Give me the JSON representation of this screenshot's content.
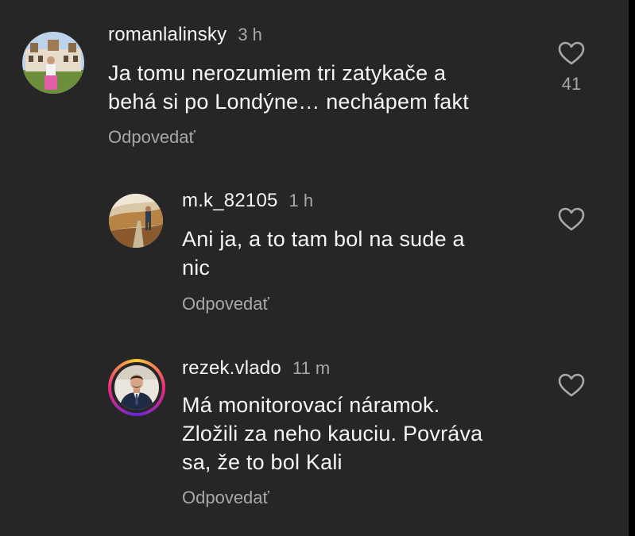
{
  "comments": [
    {
      "username": "romanlalinsky",
      "time": "3 h",
      "text_lines": [
        "Ja tomu nerozumiem tri zatykače a",
        "behá si po Londýne… nechápem fakt"
      ],
      "reply_label": "Odpovedať",
      "likes": "41",
      "like_icon": "heart-outline-icon"
    },
    {
      "username": "m.k_82105",
      "time": "1 h",
      "text_lines": [
        "Ani ja, a to tam bol na sude a",
        "nic"
      ],
      "reply_label": "Odpovedať",
      "like_icon": "heart-outline-icon"
    },
    {
      "username": "rezek.vlado",
      "time": "11 m",
      "text_lines": [
        "Má monitorovací náramok.",
        "Zložili za neho kauciu. Povráva",
        "sa, že to bol Kali"
      ],
      "reply_label": "Odpovedať",
      "like_icon": "heart-outline-icon",
      "has_story_ring": true
    }
  ],
  "colors": {
    "background": "#262626",
    "primary_text": "#f5f5f5",
    "secondary_text": "#a8a8a8"
  }
}
